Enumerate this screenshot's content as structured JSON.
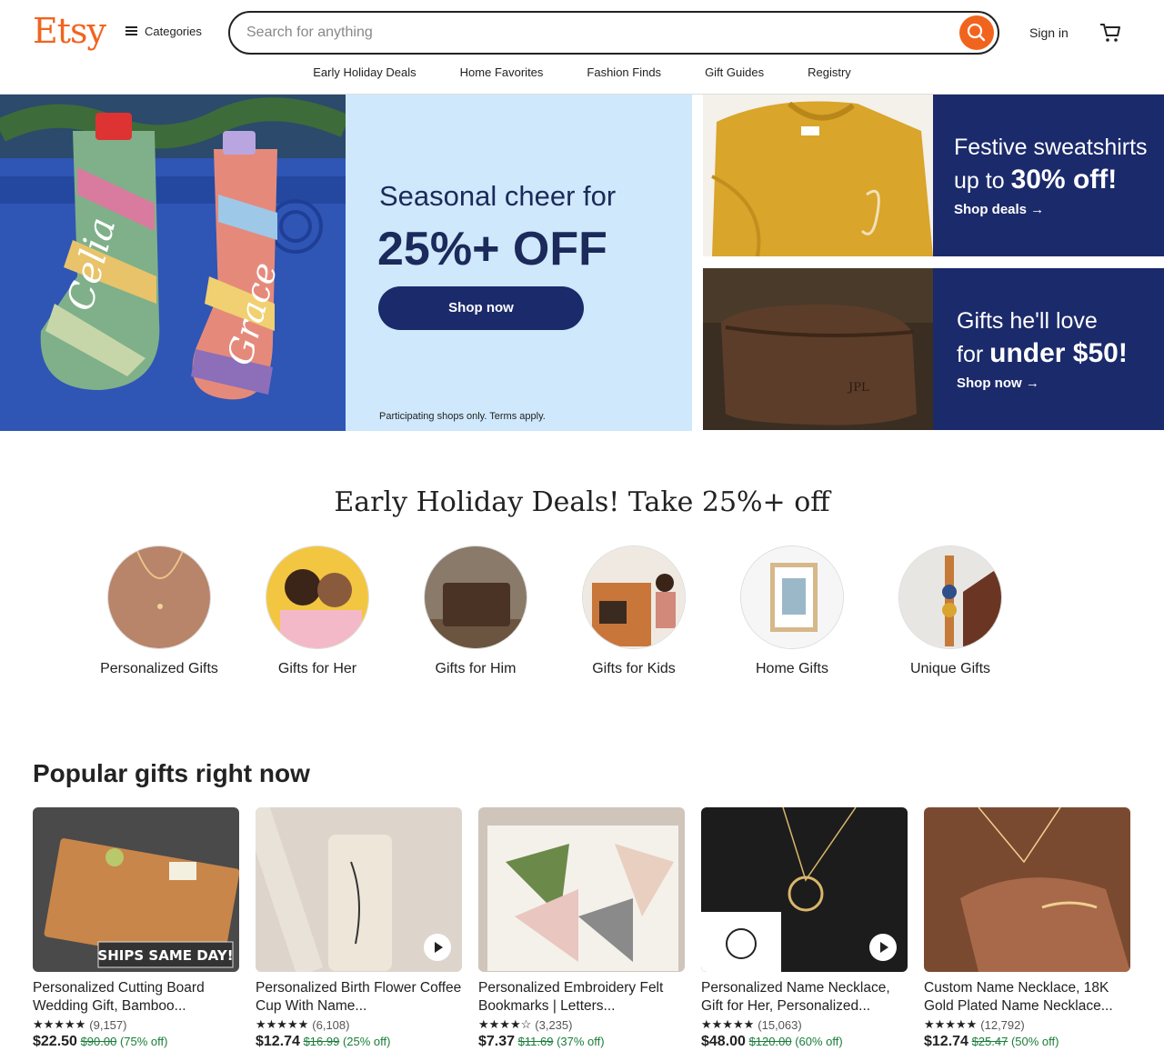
{
  "header": {
    "logo": "Etsy",
    "categories_label": "Categories",
    "search_placeholder": "Search for anything",
    "signin_label": "Sign in"
  },
  "nav": [
    "Early Holiday Deals",
    "Home Favorites",
    "Fashion Finds",
    "Gift Guides",
    "Registry"
  ],
  "hero": {
    "headline": "Seasonal cheer for",
    "offer": "25%+ OFF",
    "button": "Shop now",
    "fine_print": "Participating shops only. Terms apply."
  },
  "promos": [
    {
      "line1": "Festive sweatshirts",
      "line2_pre": "up to ",
      "line2_bold": "30% off!",
      "link": "Shop deals  →"
    },
    {
      "line1": "Gifts he'll love",
      "line2_pre": "for ",
      "line2_bold": "under $50!",
      "link": "Shop now  →"
    }
  ],
  "deals_section": {
    "title": "Early Holiday Deals! Take 25%+ off",
    "categories": [
      "Personalized Gifts",
      "Gifts for Her",
      "Gifts for Him",
      "Gifts for Kids",
      "Home Gifts",
      "Unique Gifts"
    ]
  },
  "popular": {
    "title": "Popular gifts right now",
    "products": [
      {
        "name": "Personalized Cutting Board Wedding Gift, Bamboo...",
        "stars": "★★★★★",
        "reviews": "(9,157)",
        "price": "$22.50",
        "orig": "$90.00",
        "off": "(75% off)"
      },
      {
        "name": "Personalized Birth Flower Coffee Cup With Name...",
        "stars": "★★★★★",
        "reviews": "(6,108)",
        "price": "$12.74",
        "orig": "$16.99",
        "off": "(25% off)"
      },
      {
        "name": "Personalized Embroidery Felt Bookmarks | Letters...",
        "stars": "★★★★☆",
        "reviews": "(3,235)",
        "price": "$7.37",
        "orig": "$11.69",
        "off": "(37% off)"
      },
      {
        "name": "Personalized Name Necklace, Gift for Her, Personalized...",
        "stars": "★★★★★",
        "reviews": "(15,063)",
        "price": "$48.00",
        "orig": "$120.00",
        "off": "(60% off)"
      },
      {
        "name": "Custom Name Necklace, 18K Gold Plated Name Necklace...",
        "stars": "★★★★★",
        "reviews": "(12,792)",
        "price": "$12.74",
        "orig": "$25.47",
        "off": "(50% off)"
      }
    ]
  },
  "image_text": {
    "stocking1": "Celia",
    "stocking2": "Grace",
    "ships": "SHIPS SAME DAY!",
    "bag_initials": "JPL"
  },
  "colors": {
    "brand": "#f1641e",
    "navy": "#1b2a6b",
    "hero_bg": "#cfe8fb",
    "sale_green": "#1a7d3a"
  }
}
